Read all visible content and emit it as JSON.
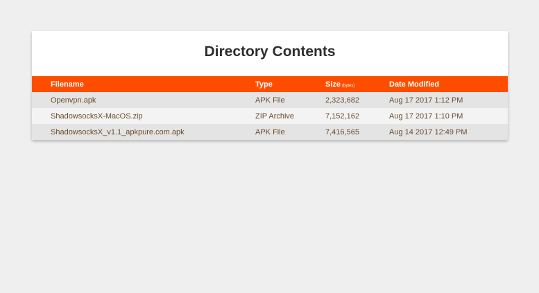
{
  "title": "Directory Contents",
  "table": {
    "headers": {
      "filename": "Filename",
      "type": "Type",
      "size": "Size",
      "size_unit": "(bytes)",
      "date": "Date Modified"
    },
    "rows": [
      {
        "filename": "Openvpn.apk",
        "type": "APK File",
        "size": "2,323,682",
        "date": "Aug 17 2017 1:12 PM"
      },
      {
        "filename": "ShadowsocksX-MacOS.zip",
        "type": "ZIP Archive",
        "size": "7,152,162",
        "date": "Aug 17 2017 1:10 PM"
      },
      {
        "filename": "ShadowsocksX_v1.1_apkpure.com.apk",
        "type": "APK File",
        "size": "7,416,565",
        "date": "Aug 14 2017 12:49 PM"
      }
    ]
  },
  "colors": {
    "header_bg": "#ff4d00",
    "page_bg": "#efefef",
    "row_text": "#6b4a2a"
  }
}
